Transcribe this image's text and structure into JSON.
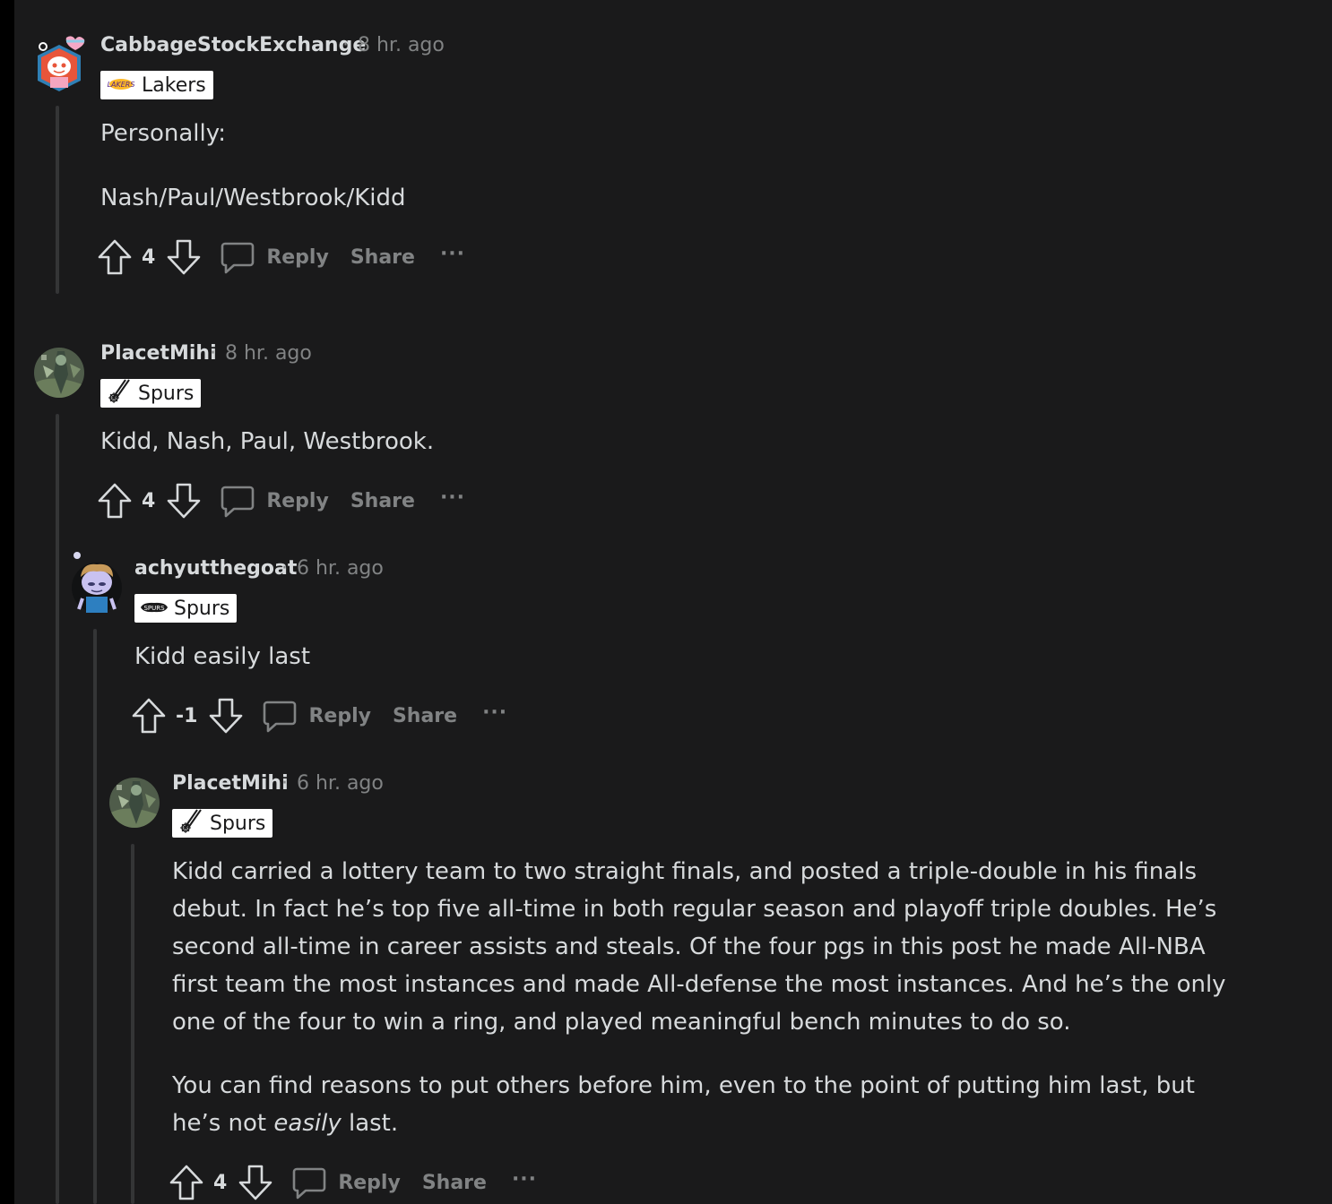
{
  "comments": [
    {
      "username": "CabbageStockExchange",
      "separator": "·",
      "time": "8 hr. ago",
      "flair": "Lakers",
      "paragraphs": [
        "Personally:",
        "Nash/Paul/Westbrook/Kidd"
      ],
      "score": "4",
      "reply_label": "Reply",
      "share_label": "Share",
      "more_label": "···"
    },
    {
      "username": "PlacetMihi",
      "separator": "·",
      "time": "8 hr. ago",
      "flair": "Spurs",
      "paragraphs": [
        "Kidd, Nash, Paul, Westbrook."
      ],
      "score": "4",
      "reply_label": "Reply",
      "share_label": "Share",
      "more_label": "···"
    },
    {
      "username": "achyutthegoat",
      "separator": "·",
      "time": "6 hr. ago",
      "flair": "Spurs",
      "paragraphs": [
        "Kidd easily last"
      ],
      "score": "-1",
      "reply_label": "Reply",
      "share_label": "Share",
      "more_label": "···"
    },
    {
      "username": "PlacetMihi",
      "separator": "·",
      "time": "6 hr. ago",
      "flair": "Spurs",
      "paragraphs": [
        "Kidd carried a lottery team to two straight finals, and posted a triple-double in his finals debut. In fact he’s top five all-time in both regular season and playoff triple doubles. He’s second all-time in career assists and steals. Of the four pgs in this post he made All-NBA first team the most instances and made All-defense the most instances. And he’s the only one of the four to win a ring, and played meaningful bench minutes to do so."
      ],
      "p2_before": "You can find reasons to put others before him, even to the point of putting him last, but he’s not ",
      "p2_emph": "easily",
      "p2_after": " last.",
      "score": "4",
      "reply_label": "Reply",
      "share_label": "Share",
      "more_label": "···"
    }
  ],
  "colors": {
    "background": "#1a1a1b",
    "text": "#d7dadc",
    "muted": "#818384",
    "thread_line": "#343536",
    "flair_bg": "#ffffff"
  },
  "icons": [
    "upvote-icon",
    "downvote-icon",
    "comment-icon",
    "lakers-logo-icon",
    "spurs-spur-icon",
    "spurs-wordmark-icon"
  ]
}
